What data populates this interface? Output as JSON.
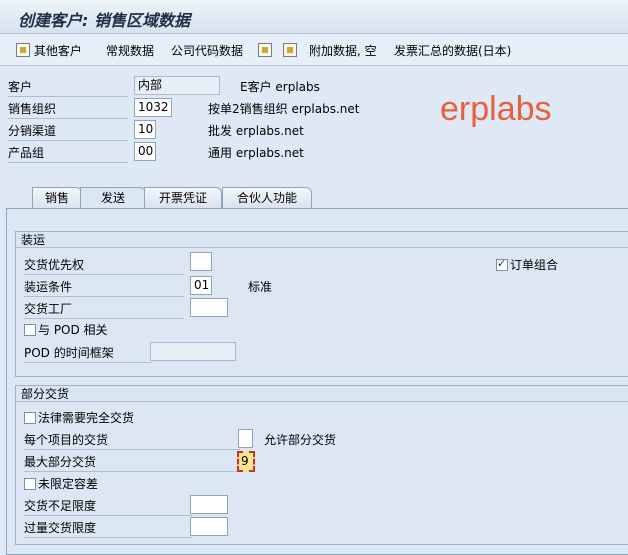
{
  "window": {
    "title": "创建客户: 销售区域数据"
  },
  "toolbar": {
    "other_customer": "其他客户",
    "general_data": "常规数据",
    "company_code_data": "公司代码数据",
    "additional_data": "附加数据, 空",
    "invoice_summary": "发票汇总的数据(日本)"
  },
  "header": {
    "customer_label": "客户",
    "customer_value": "内部",
    "customer_desc": "E客户 erplabs",
    "sales_org_label": "销售组织",
    "sales_org_value": "1032",
    "sales_org_desc": "按单2销售组织 erplabs.net",
    "dist_channel_label": "分销渠道",
    "dist_channel_value": "10",
    "dist_channel_desc": "批发 erplabs.net",
    "division_label": "产品组",
    "division_value": "00",
    "division_desc": "通用 erplabs.net"
  },
  "watermark": "erplabs",
  "tabs": [
    {
      "label": "销售"
    },
    {
      "label": "发送"
    },
    {
      "label": "开票凭证"
    },
    {
      "label": "合伙人功能"
    }
  ],
  "shipping": {
    "title": "装运",
    "delivery_priority_label": "交货优先权",
    "delivery_priority_value": "",
    "order_combination_label": "订单组合",
    "shipping_cond_label": "装运条件",
    "shipping_cond_value": "01",
    "shipping_cond_desc": "标准",
    "delivery_plant_label": "交货工厂",
    "delivery_plant_value": "",
    "pod_relevant_label": "与 POD 相关",
    "pod_timeframe_label": "POD 的时间框架",
    "pod_timeframe_value": ""
  },
  "partial": {
    "title": "部分交货",
    "complete_delivery_label": "法律需要完全交货",
    "per_item_label": "每个项目的交货",
    "per_item_value": "",
    "per_item_desc": "允许部分交货",
    "max_partial_label": "最大部分交货",
    "max_partial_value": "9",
    "unlimited_tol_label": "未限定容差",
    "underdelivery_label": "交货不足限度",
    "underdelivery_value": "",
    "overdelivery_label": "过量交货限度",
    "overdelivery_value": ""
  }
}
